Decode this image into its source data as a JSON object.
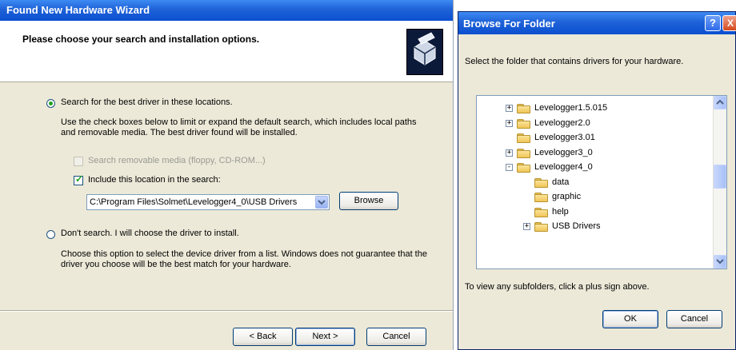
{
  "wizard": {
    "title": "Found New Hardware Wizard",
    "header_text": "Please choose your search and installation options.",
    "hardware_icon": "hardware-install-icon",
    "option_search": {
      "label": "Search for the best driver in these locations.",
      "selected": true,
      "description": "Use the check boxes below to limit or expand the default search, which includes local paths and removable media. The best driver found will be installed.",
      "removable_media": {
        "label": "Search removable media (floppy, CD-ROM...)",
        "checked": false,
        "enabled": false
      },
      "include_location": {
        "label": "Include this location in the search:",
        "checked": true
      },
      "path_value": "C:\\Program Files\\Solmet\\Levelogger4_0\\USB Drivers",
      "browse_label": "Browse"
    },
    "option_manual": {
      "label": "Don't search. I will choose the driver to install.",
      "selected": false,
      "description": "Choose this option to select the device driver from a list. Windows does not guarantee that the driver you choose will be the best match for your hardware."
    },
    "buttons": {
      "back": "< Back",
      "next": "Next >",
      "cancel": "Cancel"
    }
  },
  "browse_dialog": {
    "title": "Browse For Folder",
    "help_label": "?",
    "close_label": "X",
    "instruction": "Select the folder that contains drivers for your hardware.",
    "tree": [
      {
        "label": "Levelogger1.5.015",
        "expander": "+"
      },
      {
        "label": "Levelogger2.0",
        "expander": "+"
      },
      {
        "label": "Levelogger3.01",
        "expander": ""
      },
      {
        "label": "Levelogger3_0",
        "expander": "+"
      },
      {
        "label": "Levelogger4_0",
        "expander": "-"
      },
      {
        "label": "data",
        "expander": ""
      },
      {
        "label": "graphic",
        "expander": ""
      },
      {
        "label": "help",
        "expander": ""
      },
      {
        "label": "USB Drivers",
        "expander": "+"
      }
    ],
    "hint": "To view any subfolders, click a plus sign above.",
    "ok_label": "OK",
    "cancel_label": "Cancel"
  }
}
